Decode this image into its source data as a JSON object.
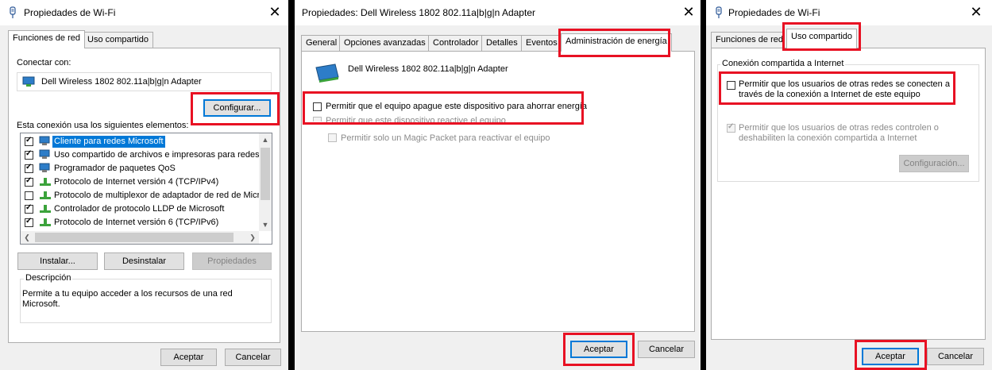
{
  "colors": {
    "highlight_red": "#e81123",
    "selection_blue": "#0078d7",
    "dialog_bg": "#f0f0f0"
  },
  "dialog1": {
    "icon": "wifi-properties-icon",
    "title": "Propiedades de Wi-Fi",
    "close": "✕",
    "tabs": [
      "Funciones de red",
      "Uso compartido"
    ],
    "connect_label": "Conectar con:",
    "adapter_icon": "network-adapter-icon",
    "adapter_name": "Dell Wireless 1802 802.11a|b|g|n Adapter",
    "configure_button": "Configurar...",
    "items_label": "Esta conexión usa los siguientes elementos:",
    "items": [
      {
        "label": "Cliente para redes Microsoft",
        "checked": true,
        "selected": true,
        "icon": "network-client-icon"
      },
      {
        "label": "Uso compartido de archivos e impresoras para redes M",
        "checked": true,
        "selected": false,
        "icon": "network-client-icon"
      },
      {
        "label": "Programador de paquetes QoS",
        "checked": true,
        "selected": false,
        "icon": "network-client-icon"
      },
      {
        "label": "Protocolo de Internet versión 4 (TCP/IPv4)",
        "checked": true,
        "selected": false,
        "icon": "protocol-icon"
      },
      {
        "label": "Protocolo de multiplexor de adaptador de red de Micros",
        "checked": false,
        "selected": false,
        "icon": "protocol-icon"
      },
      {
        "label": "Controlador de protocolo LLDP de Microsoft",
        "checked": true,
        "selected": false,
        "icon": "protocol-icon"
      },
      {
        "label": "Protocolo de Internet versión 6 (TCP/IPv6)",
        "checked": true,
        "selected": false,
        "icon": "protocol-icon"
      }
    ],
    "install_button": "Instalar...",
    "uninstall_button": "Desinstalar",
    "properties_button": "Propiedades",
    "description_label": "Descripción",
    "description_text": "Permite a tu equipo acceder a los recursos de una red Microsoft.",
    "ok_button": "Aceptar",
    "cancel_button": "Cancelar"
  },
  "dialog2": {
    "title": "Propiedades: Dell Wireless 1802 802.11a|b|g|n Adapter",
    "close": "✕",
    "tabs": [
      "General",
      "Opciones avanzadas",
      "Controlador",
      "Detalles",
      "Eventos",
      "Administración de energía"
    ],
    "adapter_icon": "network-adapter-icon",
    "adapter_name": "Dell Wireless 1802 802.11a|b|g|n Adapter",
    "option_power_off": {
      "label": "Permitir que el equipo apague este dispositivo para ahorrar energía",
      "checked": false
    },
    "option_wake": {
      "label": "Permitir que este dispositivo reactive el equipo",
      "checked": false
    },
    "option_magic": {
      "label": "Permitir solo un Magic Packet para reactivar el equipo",
      "checked": false
    },
    "ok_button": "Aceptar",
    "cancel_button": "Cancelar"
  },
  "dialog3": {
    "icon": "wifi-properties-icon",
    "title": "Propiedades de Wi-Fi",
    "close": "✕",
    "tabs": [
      "Funciones de red",
      "Uso compartido"
    ],
    "group_label": "Conexión compartida a Internet",
    "allow_share": {
      "label": "Permitir que los usuarios de otras redes se conecten a través de la conexión a Internet de este equipo",
      "checked": false
    },
    "allow_control": {
      "label": "Permitir que los usuarios de otras redes controlen o deshabiliten la conexión compartida a Internet",
      "checked": true
    },
    "config_button": "Configuración...",
    "ok_button": "Aceptar",
    "cancel_button": "Cancelar"
  }
}
